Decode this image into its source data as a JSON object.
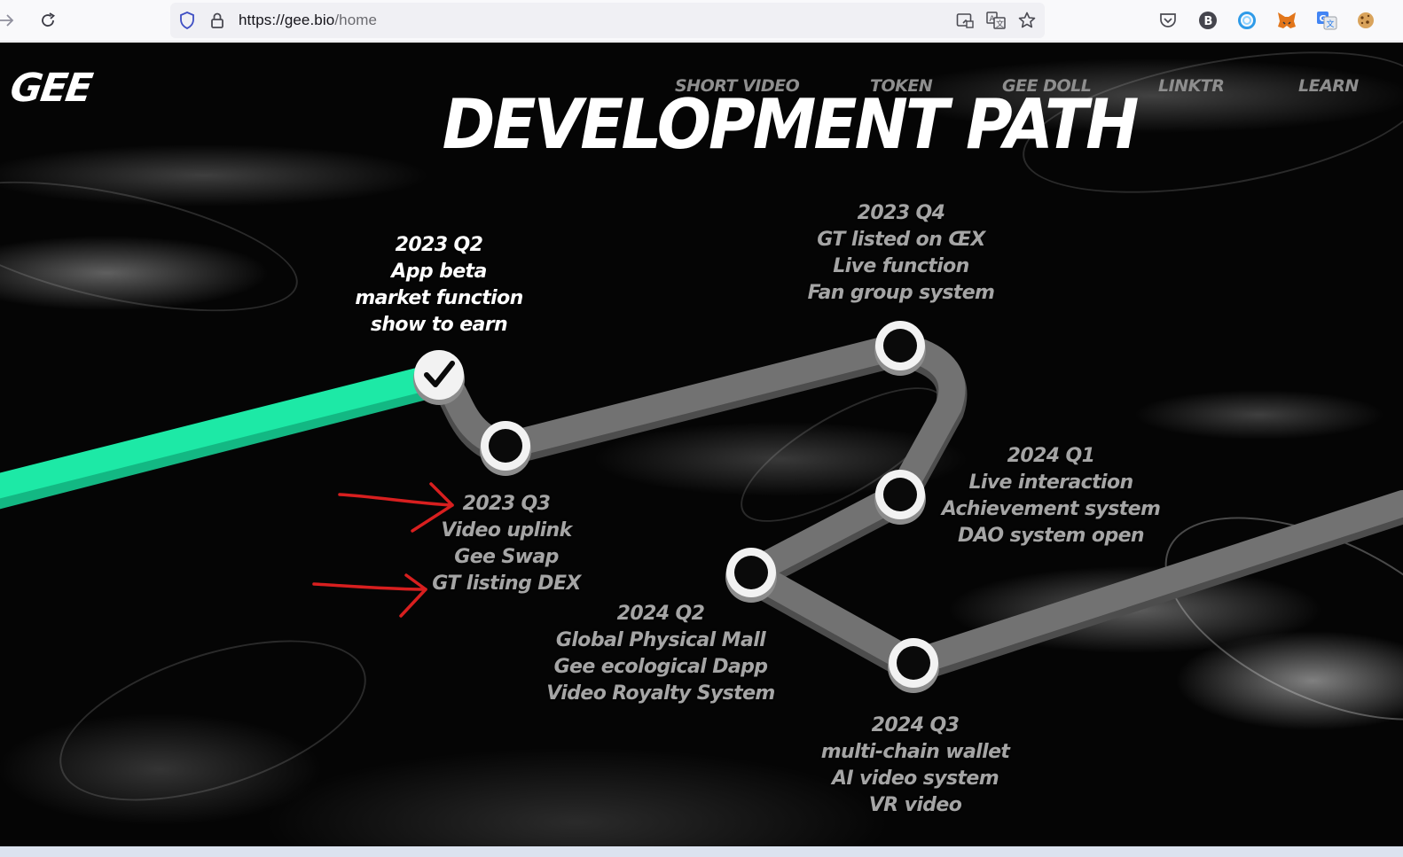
{
  "browser": {
    "url_host": "https://gee.bio",
    "url_path": "/home",
    "icons": [
      "back-arrow-icon",
      "reload-icon",
      "shield-icon",
      "lock-icon",
      "reader-view-icon",
      "translate-icon",
      "star-icon",
      "pocket-icon",
      "extension-b-icon",
      "extension-ring-icon",
      "metamask-icon",
      "translate-extension-icon",
      "cookie-icon"
    ]
  },
  "site": {
    "logo": "GEE",
    "nav": [
      "SHORT VIDEO",
      "TOKEN",
      "GEE DOLL",
      "LINKTR",
      "LEARN"
    ],
    "title": "DEVELOPMENT PATH"
  },
  "milestones": [
    {
      "id": "2023-q2",
      "status": "done",
      "lines": [
        "2023 Q2",
        "App beta",
        "market function",
        "show to earn"
      ]
    },
    {
      "id": "2023-q3",
      "status": "pending",
      "lines": [
        "2023 Q3",
        "Video uplink",
        "Gee Swap",
        "GT listing DEX"
      ]
    },
    {
      "id": "2023-q4",
      "status": "pending",
      "lines": [
        "2023 Q4",
        "GT listed on ŒX",
        "Live function",
        "Fan group system"
      ]
    },
    {
      "id": "2024-q1",
      "status": "pending",
      "lines": [
        "2024 Q1",
        "Live interaction",
        "Achievement system",
        "DAO system open"
      ]
    },
    {
      "id": "2024-q2",
      "status": "pending",
      "lines": [
        "2024 Q2",
        "Global Physical Mall",
        "Gee ecological Dapp",
        "Video Royalty System"
      ]
    },
    {
      "id": "2024-q3",
      "status": "pending",
      "lines": [
        "2024 Q3",
        "multi-chain wallet",
        "AI video system",
        "VR video"
      ]
    }
  ],
  "colors": {
    "progress": "#1de9a6",
    "track": "#6a6a6a",
    "annotation_arrow": "#d81f1f",
    "node_ring": "#ffffff",
    "node_fill": "#0a0a0a"
  }
}
